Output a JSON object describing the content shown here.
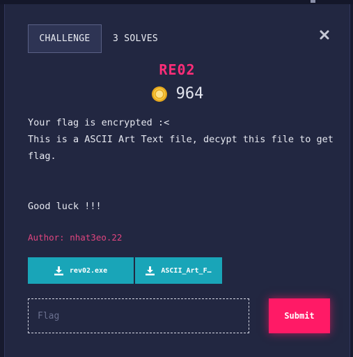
{
  "tabs": {
    "challenge_label": "CHALLENGE",
    "solves_label": "3 SOLVES"
  },
  "challenge": {
    "title": "RE02",
    "points": "964",
    "description_lines": [
      "Your flag is encrypted :<",
      "This is a ASCII Art Text file, decypt this file to get flag.",
      "",
      "",
      "Good luck !!!"
    ],
    "author": "Author: nhat3eo.22"
  },
  "files": [
    {
      "name": "rev02.exe"
    },
    {
      "name": "ASCII_Art_F…"
    }
  ],
  "form": {
    "flag_placeholder": "Flag",
    "flag_value": "",
    "submit_label": "Submit"
  },
  "icons": {
    "close": "close-icon",
    "coin": "coin-icon",
    "download": "download-icon"
  },
  "colors": {
    "accent_pink": "#ff1a66",
    "title_pink": "#ff2d78",
    "file_button": "#19a5b8",
    "modal_bg": "#222741"
  }
}
